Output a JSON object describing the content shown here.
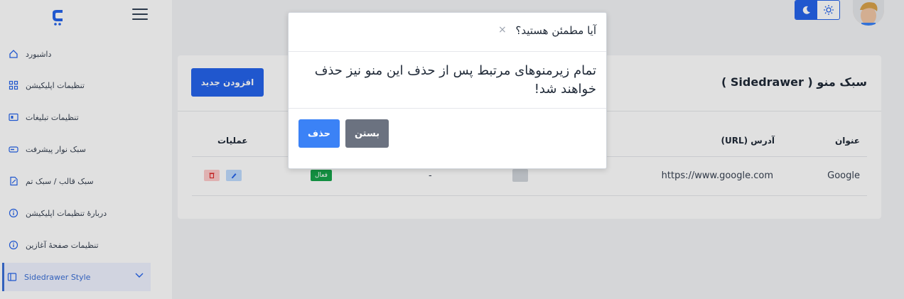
{
  "sidebar": {
    "items": [
      {
        "label": "داشبورد",
        "icon": "home-icon"
      },
      {
        "label": "تنظیمات اپلیکیشن",
        "icon": "grid-icon"
      },
      {
        "label": "تنظیمات تبلیغات",
        "icon": "ad-icon"
      },
      {
        "label": "سبک نوار پیشرفت",
        "icon": "progress-icon"
      },
      {
        "label": "سبک قالب / سبک تم",
        "icon": "theme-icon"
      },
      {
        "label": "دربارهٔ تنظیمات اپلیکیشن",
        "icon": "info-icon"
      },
      {
        "label": "تنظیمات صفحهٔ آغازین",
        "icon": "info-icon"
      },
      {
        "label": "Sidedrawer Style",
        "icon": "sidebar-icon"
      }
    ]
  },
  "page": {
    "title": "سبک منو ( Sidedrawer )",
    "add_button": "افزودن جدید"
  },
  "table": {
    "headers": {
      "title": "عنوان",
      "url": "آدرس (URL)",
      "actions": "عملیات"
    },
    "rows": [
      {
        "title": "Google",
        "url": "https://www.google.com",
        "dash": "-",
        "status": "فعال"
      }
    ]
  },
  "modal": {
    "title": "آیا مطمئن هستید؟",
    "close_symbol": "×",
    "message": "تمام زیرمنوهای مرتبط پس از حذف این منو نیز حذف خواهند شد!",
    "delete_label": "حذف",
    "close_label": "بستن"
  },
  "colors": {
    "primary": "#2563eb",
    "delete_button": "#3b82f6",
    "close_button": "#6b7280",
    "status_active": "#16a34a"
  }
}
